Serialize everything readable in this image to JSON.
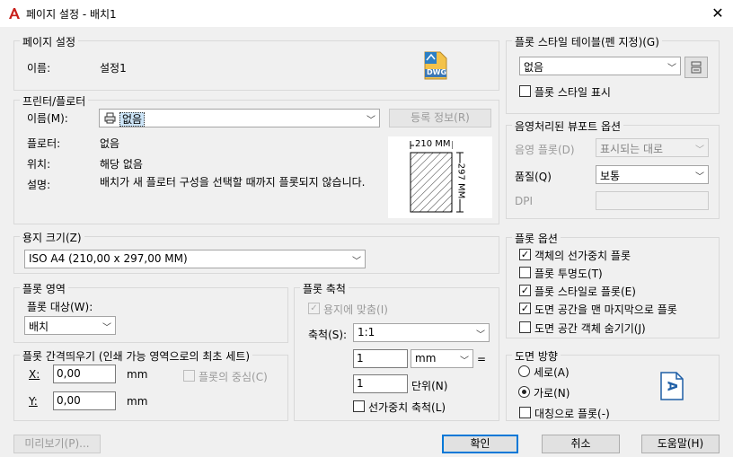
{
  "window": {
    "title": "페이지 설정 - 배치1",
    "close": "✕"
  },
  "page_setup": {
    "legend": "페이지 설정",
    "name_label": "이름:",
    "name_value": "설정1"
  },
  "printer": {
    "legend": "프린터/플로터",
    "name_label": "이름(M):",
    "name_value": "없음",
    "properties_button": "등록 정보(R)",
    "plotter_label": "플로터:",
    "plotter_value": "없음",
    "location_label": "위치:",
    "location_value": "해당 없음",
    "description_label": "설명:",
    "description_value": "배치가 새 플로터 구성을 선택할 때까지 플롯되지 않습니다."
  },
  "paper_preview": {
    "width_text": "210 MM",
    "height_text": "297 MM"
  },
  "paper_size": {
    "legend": "용지 크기(Z)",
    "value": "ISO A4 (210,00 x 297,00 MM)"
  },
  "plot_area": {
    "legend": "플롯 영역",
    "what_label": "플롯 대상(W):",
    "what_value": "배치"
  },
  "plot_offset": {
    "legend": "플롯 간격띄우기 (인쇄 가능 영역으로의 최초 세트)",
    "x_label": "X:",
    "x_value": "0,00",
    "x_unit": "mm",
    "y_label": "Y:",
    "y_value": "0,00",
    "y_unit": "mm",
    "center_label": "플롯의 중심(C)"
  },
  "plot_scale": {
    "legend": "플롯 축척",
    "fit_label": "용지에 맞춤(I)",
    "scale_label": "축척(S):",
    "scale_value": "1:1",
    "value1": "1",
    "unit_value": "mm",
    "equals": "=",
    "value2": "1",
    "unit_label": "단위(N)",
    "lineweight_label": "선가중치 축척(L)"
  },
  "plot_style_table": {
    "legend": "플롯 스타일 테이블(펜 지정)(G)",
    "value": "없음",
    "display_label": "플롯 스타일 표시"
  },
  "shaded_viewport": {
    "legend": "음영처리된 뷰포트 옵션",
    "shade_label": "음영 플롯(D)",
    "shade_value": "표시되는 대로",
    "quality_label": "품질(Q)",
    "quality_value": "보통",
    "dpi_label": "DPI"
  },
  "plot_options": {
    "legend": "플롯 옵션",
    "items": [
      {
        "label": "객체의 선가중치 플롯",
        "checked": true
      },
      {
        "label": "플롯 투명도(T)",
        "checked": false
      },
      {
        "label": "플롯 스타일로 플롯(E)",
        "checked": true
      },
      {
        "label": "도면 공간을 맨 마지막으로 플롯",
        "checked": true
      },
      {
        "label": "도면 공간 객체 숨기기(J)",
        "checked": false
      }
    ]
  },
  "orientation": {
    "legend": "도면 방향",
    "portrait_label": "세로(A)",
    "landscape_label": "가로(N)",
    "upside_down_label": "대칭으로 플롯(-)",
    "icon_letter": "A"
  },
  "buttons": {
    "preview": "미리보기(P)...",
    "ok": "확인",
    "cancel": "취소",
    "help": "도움말(H)"
  },
  "dwg_icon_text": "DWG",
  "check_mark": "✓"
}
